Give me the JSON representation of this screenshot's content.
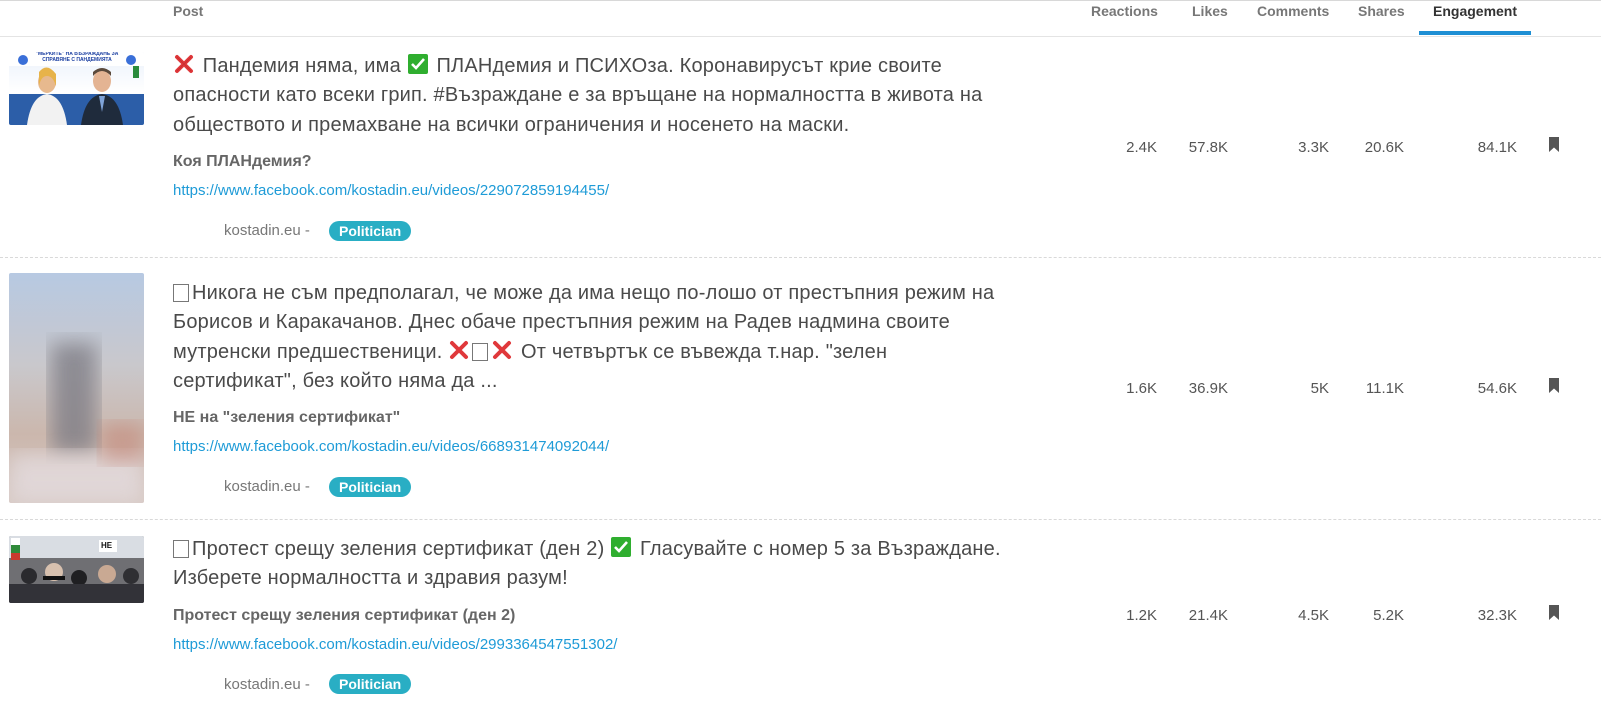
{
  "header": {
    "post": "Post",
    "reactions": "Reactions",
    "likes": "Likes",
    "comments": "Comments",
    "shares": "Shares",
    "engagement": "Engagement"
  },
  "rows": [
    {
      "text_a": "Пандемия няма, има",
      "text_b": "ПЛАНдемия и ПСИХОза. Коронавирусът крие своите опасности като всеки грип. #Възраждане е за връщане на нормалността в живота на обществото и премахване на всички ограничения и носенето на маски.",
      "title": "Коя ПЛАНдемия?",
      "link": "https://www.facebook.com/kostadin.eu/videos/229072859194455/",
      "author": "kostadin.eu -",
      "badge": "Politician",
      "thumb_text": "\"МЕРКИТЕ\" НА ВЪЗРАЖДАНЕ ЗА СПРАВЯНЕ С ПАНДЕМИЯТА",
      "reactions": "2.4K",
      "likes": "57.8K",
      "comments": "3.3K",
      "shares": "20.6K",
      "engagement": "84.1K"
    },
    {
      "text_a": "Никога не съм предполагал, че може да има нещо по-лошо от престъпния режим на Борисов и Каракачанов. Днес обаче престъпния режим на Радев надмина своите мутренски предшественици.",
      "text_b": "От четвъртък се въвежда т.нар. \"зелен сертификат\", без който няма да ...",
      "title": "НЕ на \"зеления сертификат\"",
      "link": "https://www.facebook.com/kostadin.eu/videos/668931474092044/",
      "author": "kostadin.eu -",
      "badge": "Politician",
      "reactions": "1.6K",
      "likes": "36.9K",
      "comments": "5K",
      "shares": "11.1K",
      "engagement": "54.6K"
    },
    {
      "text_a": "Протест срещу зеления сертификат (ден 2)",
      "text_b": "Гласувайте с номер 5 за Възраждане. Изберете нормалността и здравия разум!",
      "title": "Протест срещу зеления сертификат (ден 2)",
      "link": "https://www.facebook.com/kostadin.eu/videos/2993364547551302/",
      "author": "kostadin.eu -",
      "badge": "Politician",
      "thumb_text": "НЕ",
      "reactions": "1.2K",
      "likes": "21.4K",
      "comments": "4.5K",
      "shares": "5.2K",
      "engagement": "32.3K"
    }
  ],
  "icons": {
    "cross": "cross-mark-icon",
    "check": "check-mark-icon",
    "missing": "missing-glyph-icon",
    "bookmark": "bookmark-icon"
  },
  "colors": {
    "accent": "#1e8fd4",
    "link": "#1e9bd7",
    "badge": "#29aec4",
    "cross": "#e0383b",
    "check": "#2fae2f"
  }
}
